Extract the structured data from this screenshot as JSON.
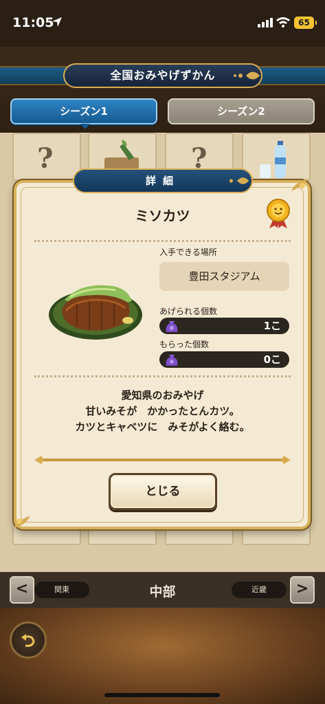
{
  "status_bar": {
    "time": "11:05",
    "battery": "65"
  },
  "header": {
    "title": "全国おみやげずかん",
    "tabs": [
      {
        "label": "シーズン1",
        "active": true
      },
      {
        "label": "シーズン2",
        "active": false
      }
    ]
  },
  "grid": {
    "unknown_mark": "?"
  },
  "modal": {
    "header": "詳細",
    "item_name": "ミソカツ",
    "location_label": "入手できる場所",
    "location_value": "豊田スタジアム",
    "giveable_label": "あげられる個数",
    "giveable_value": "1こ",
    "received_label": "もらった個数",
    "received_value": "0こ",
    "description": [
      "愛知県のおみやげ",
      "甘いみそが　かかったとんカツ。",
      "カツとキャベツに　みそがよく絡む。"
    ],
    "close_label": "とじる"
  },
  "region_nav": {
    "prev_label": "関東",
    "current": "中部",
    "next_label": "近畿",
    "prev_arrow": "<",
    "next_arrow": ">"
  },
  "colors": {
    "accent_blue": "#155a92",
    "gold": "#d6b25d",
    "panel": "#f4ead4"
  }
}
